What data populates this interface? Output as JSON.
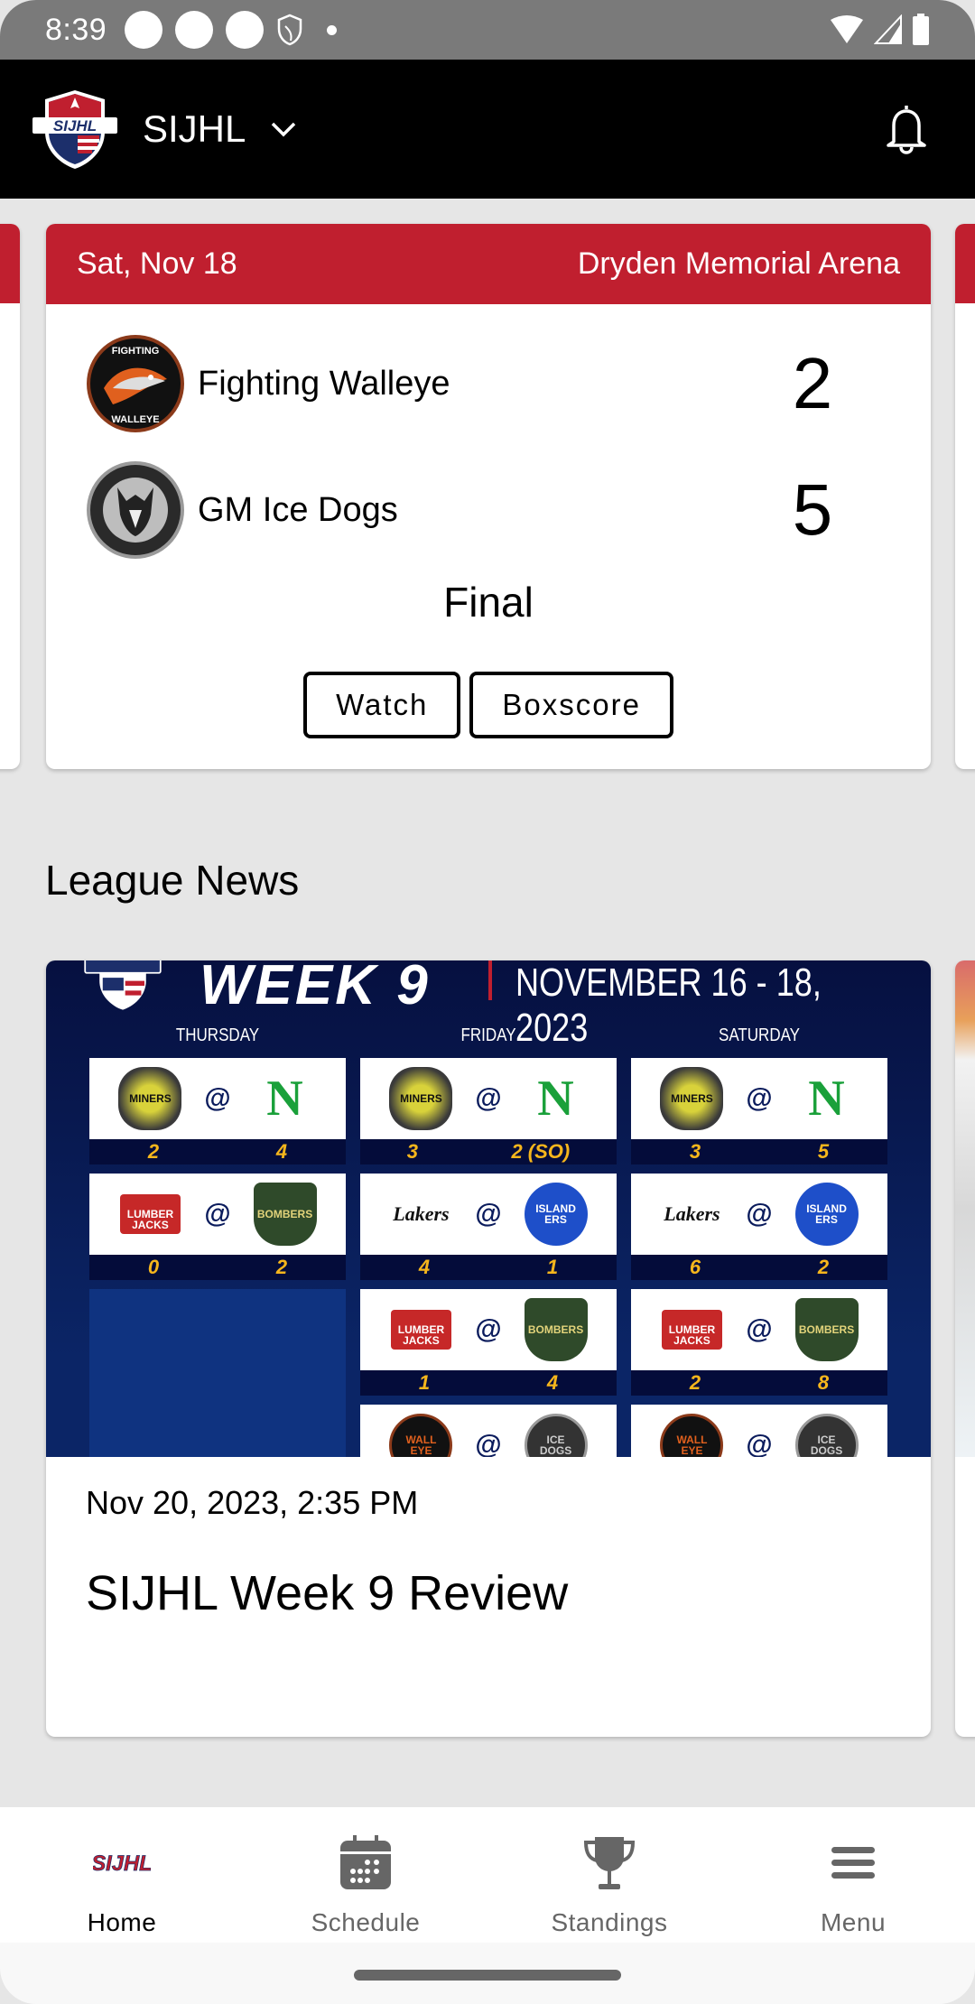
{
  "status_bar": {
    "time": "8:39",
    "icons": [
      "notification-circle",
      "notification-circle",
      "notification-circle",
      "shield-icon",
      "dot",
      "wifi-icon",
      "signal-icon",
      "battery-icon"
    ]
  },
  "app_bar": {
    "league_name": "SIJHL",
    "logo_text": "SIJHL",
    "dropdown_icon": "chevron-down-icon",
    "notification_icon": "bell-icon"
  },
  "game": {
    "date": "Sat, Nov 18",
    "venue": "Dryden Memorial Arena",
    "teams": [
      {
        "name": "Fighting Walleye",
        "score": "2",
        "logo": "fighting-walleye-logo"
      },
      {
        "name": "GM Ice Dogs",
        "score": "5",
        "logo": "gm-ice-dogs-logo"
      }
    ],
    "status": "Final",
    "buttons": {
      "watch": "Watch",
      "boxscore": "Boxscore"
    }
  },
  "news": {
    "section_title": "League News",
    "items": [
      {
        "date": "Nov 20, 2023, 2:35 PM",
        "title": "SIJHL Week 9 Review",
        "image": {
          "headline": "WEEK 9",
          "date_range": "NOVEMBER 16 - 18, 2023",
          "days": [
            {
              "label": "THURSDAY",
              "games": [
                {
                  "away": "Red Lake Miners",
                  "home": "Thunder Bay North Stars",
                  "away_score": "2",
                  "home_score": "4"
                },
                {
                  "away": "Wisconsin Lumberjacks",
                  "home": "Sioux Lookout Bombers",
                  "away_score": "0",
                  "home_score": "2"
                }
              ]
            },
            {
              "label": "FRIDAY",
              "games": [
                {
                  "away": "Red Lake Miners",
                  "home": "Thunder Bay North Stars",
                  "away_score": "3",
                  "home_score": "2 (SO)"
                },
                {
                  "away": "Lakers",
                  "home": "Kenora Islanders",
                  "away_score": "4",
                  "home_score": "1"
                },
                {
                  "away": "Wisconsin Lumberjacks",
                  "home": "Sioux Lookout Bombers",
                  "away_score": "1",
                  "home_score": "4"
                },
                {
                  "away": "Fighting Walleye",
                  "home": "GM Ice Dogs",
                  "away_score": "",
                  "home_score": ""
                }
              ]
            },
            {
              "label": "SATURDAY",
              "games": [
                {
                  "away": "Red Lake Miners",
                  "home": "Thunder Bay North Stars",
                  "away_score": "3",
                  "home_score": "5"
                },
                {
                  "away": "Lakers",
                  "home": "Kenora Islanders",
                  "away_score": "6",
                  "home_score": "2"
                },
                {
                  "away": "Wisconsin Lumberjacks",
                  "home": "Sioux Lookout Bombers",
                  "away_score": "2",
                  "home_score": "8"
                },
                {
                  "away": "Fighting Walleye",
                  "home": "GM Ice Dogs",
                  "away_score": "",
                  "home_score": ""
                }
              ]
            }
          ]
        }
      }
    ]
  },
  "bottom_nav": {
    "items": [
      {
        "label": "Home",
        "icon": "sijhl-logo-icon",
        "active": true
      },
      {
        "label": "Schedule",
        "icon": "calendar-icon",
        "active": false
      },
      {
        "label": "Standings",
        "icon": "trophy-icon",
        "active": false
      },
      {
        "label": "Menu",
        "icon": "hamburger-menu-icon",
        "active": false
      }
    ]
  },
  "colors": {
    "accent_red": "#c01f2f",
    "app_bar": "#000000",
    "background": "#e6e6e6",
    "nav_inactive": "#666666",
    "graphic_navy": "#061040",
    "score_gold": "#f6b61c"
  }
}
